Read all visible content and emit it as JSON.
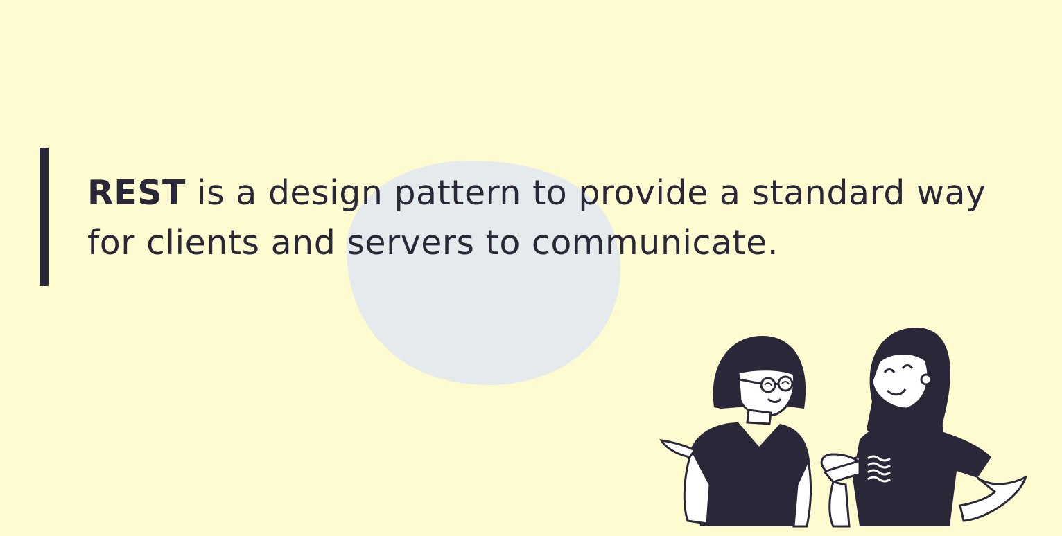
{
  "slide": {
    "background": "#fffbd1",
    "accent": "#2a2738",
    "blob_color": "#e5eaed"
  },
  "quote": {
    "term": "REST",
    "line1_rest": " is a design pattern to provide a standard way",
    "line2": "for clients and servers to communicate."
  },
  "illustration": {
    "icon": "two-people-talking-illustration"
  }
}
